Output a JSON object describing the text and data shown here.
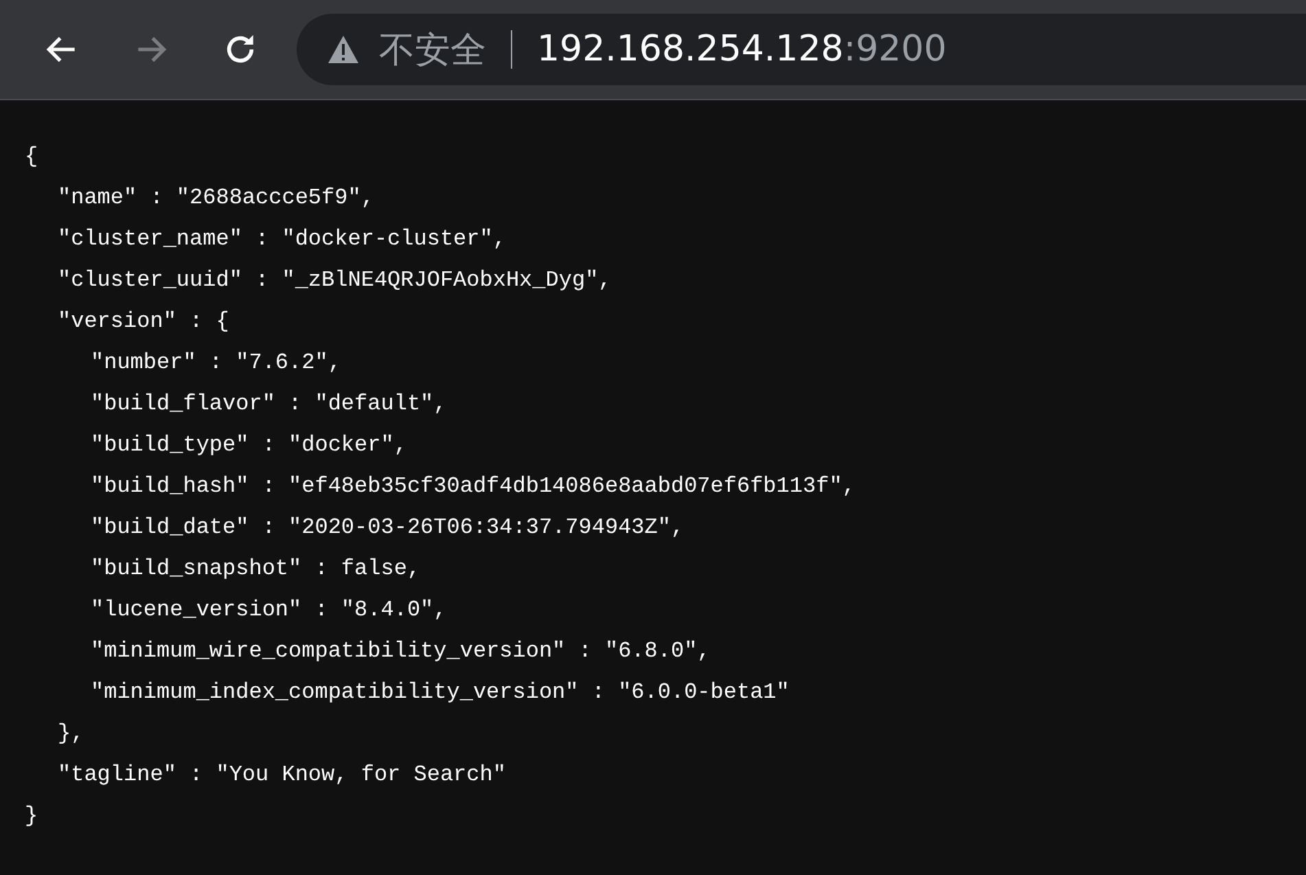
{
  "toolbar": {
    "buttons": [
      {
        "kind": "back",
        "disabled": false
      },
      {
        "kind": "forward",
        "disabled": true
      },
      {
        "kind": "reload",
        "disabled": false
      }
    ],
    "address_bar": {
      "security_label": "不安全",
      "host": "192.168.254.128",
      "port": ":9200"
    }
  },
  "document": {
    "lines": [
      {
        "text": "{",
        "children": [
          {
            "text": "\"name\" : \"2688accce5f9\","
          },
          {
            "text": "\"cluster_name\" : \"docker-cluster\","
          },
          {
            "text": "\"cluster_uuid\" : \"_zBlNE4QRJOFAobxHx_Dyg\","
          },
          {
            "text": "\"version\" : {",
            "children": [
              {
                "text": "\"number\" : \"7.6.2\","
              },
              {
                "text": "\"build_flavor\" : \"default\","
              },
              {
                "text": "\"build_type\" : \"docker\","
              },
              {
                "text": "\"build_hash\" : \"ef48eb35cf30adf4db14086e8aabd07ef6fb113f\","
              },
              {
                "text": "\"build_date\" : \"2020-03-26T06:34:37.794943Z\","
              },
              {
                "text": "\"build_snapshot\" : false,"
              },
              {
                "text": "\"lucene_version\" : \"8.4.0\","
              },
              {
                "text": "\"minimum_wire_compatibility_version\" : \"6.8.0\","
              },
              {
                "text": "\"minimum_index_compatibility_version\" : \"6.0.0-beta1\""
              }
            ]
          },
          {
            "text": "},"
          },
          {
            "text": "\"tagline\" : \"You Know, for Search\""
          }
        ]
      },
      {
        "text": "}"
      }
    ]
  }
}
